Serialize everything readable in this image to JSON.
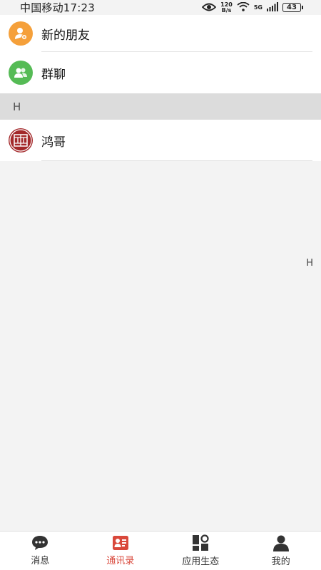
{
  "status_bar": {
    "carrier_time": "中国移动17:23",
    "net_speed_value": "120",
    "net_speed_unit": "B/s",
    "network": "5G",
    "battery": "43",
    "icons": [
      "eye-icon",
      "wifi-icon",
      "signal-icon",
      "battery-icon"
    ]
  },
  "contacts": {
    "special_items": [
      {
        "label": "新的朋友",
        "icon": "new-friend-icon",
        "color": "#f5a03a"
      },
      {
        "label": "群聊",
        "icon": "group-chat-icon",
        "color": "#55bb55"
      }
    ],
    "sections": [
      {
        "letter": "H",
        "items": [
          {
            "name": "鸿哥",
            "avatar_color": "#a3282a"
          }
        ]
      }
    ],
    "index_bar": [
      "H"
    ]
  },
  "tabbar": {
    "active": "通讯录",
    "tabs": [
      {
        "label": "消息",
        "icon": "chat-bubble-icon"
      },
      {
        "label": "通讯录",
        "icon": "contacts-card-icon"
      },
      {
        "label": "应用生态",
        "icon": "app-grid-icon"
      },
      {
        "label": "我的",
        "icon": "person-icon"
      }
    ],
    "accent_color": "#d9483b"
  }
}
